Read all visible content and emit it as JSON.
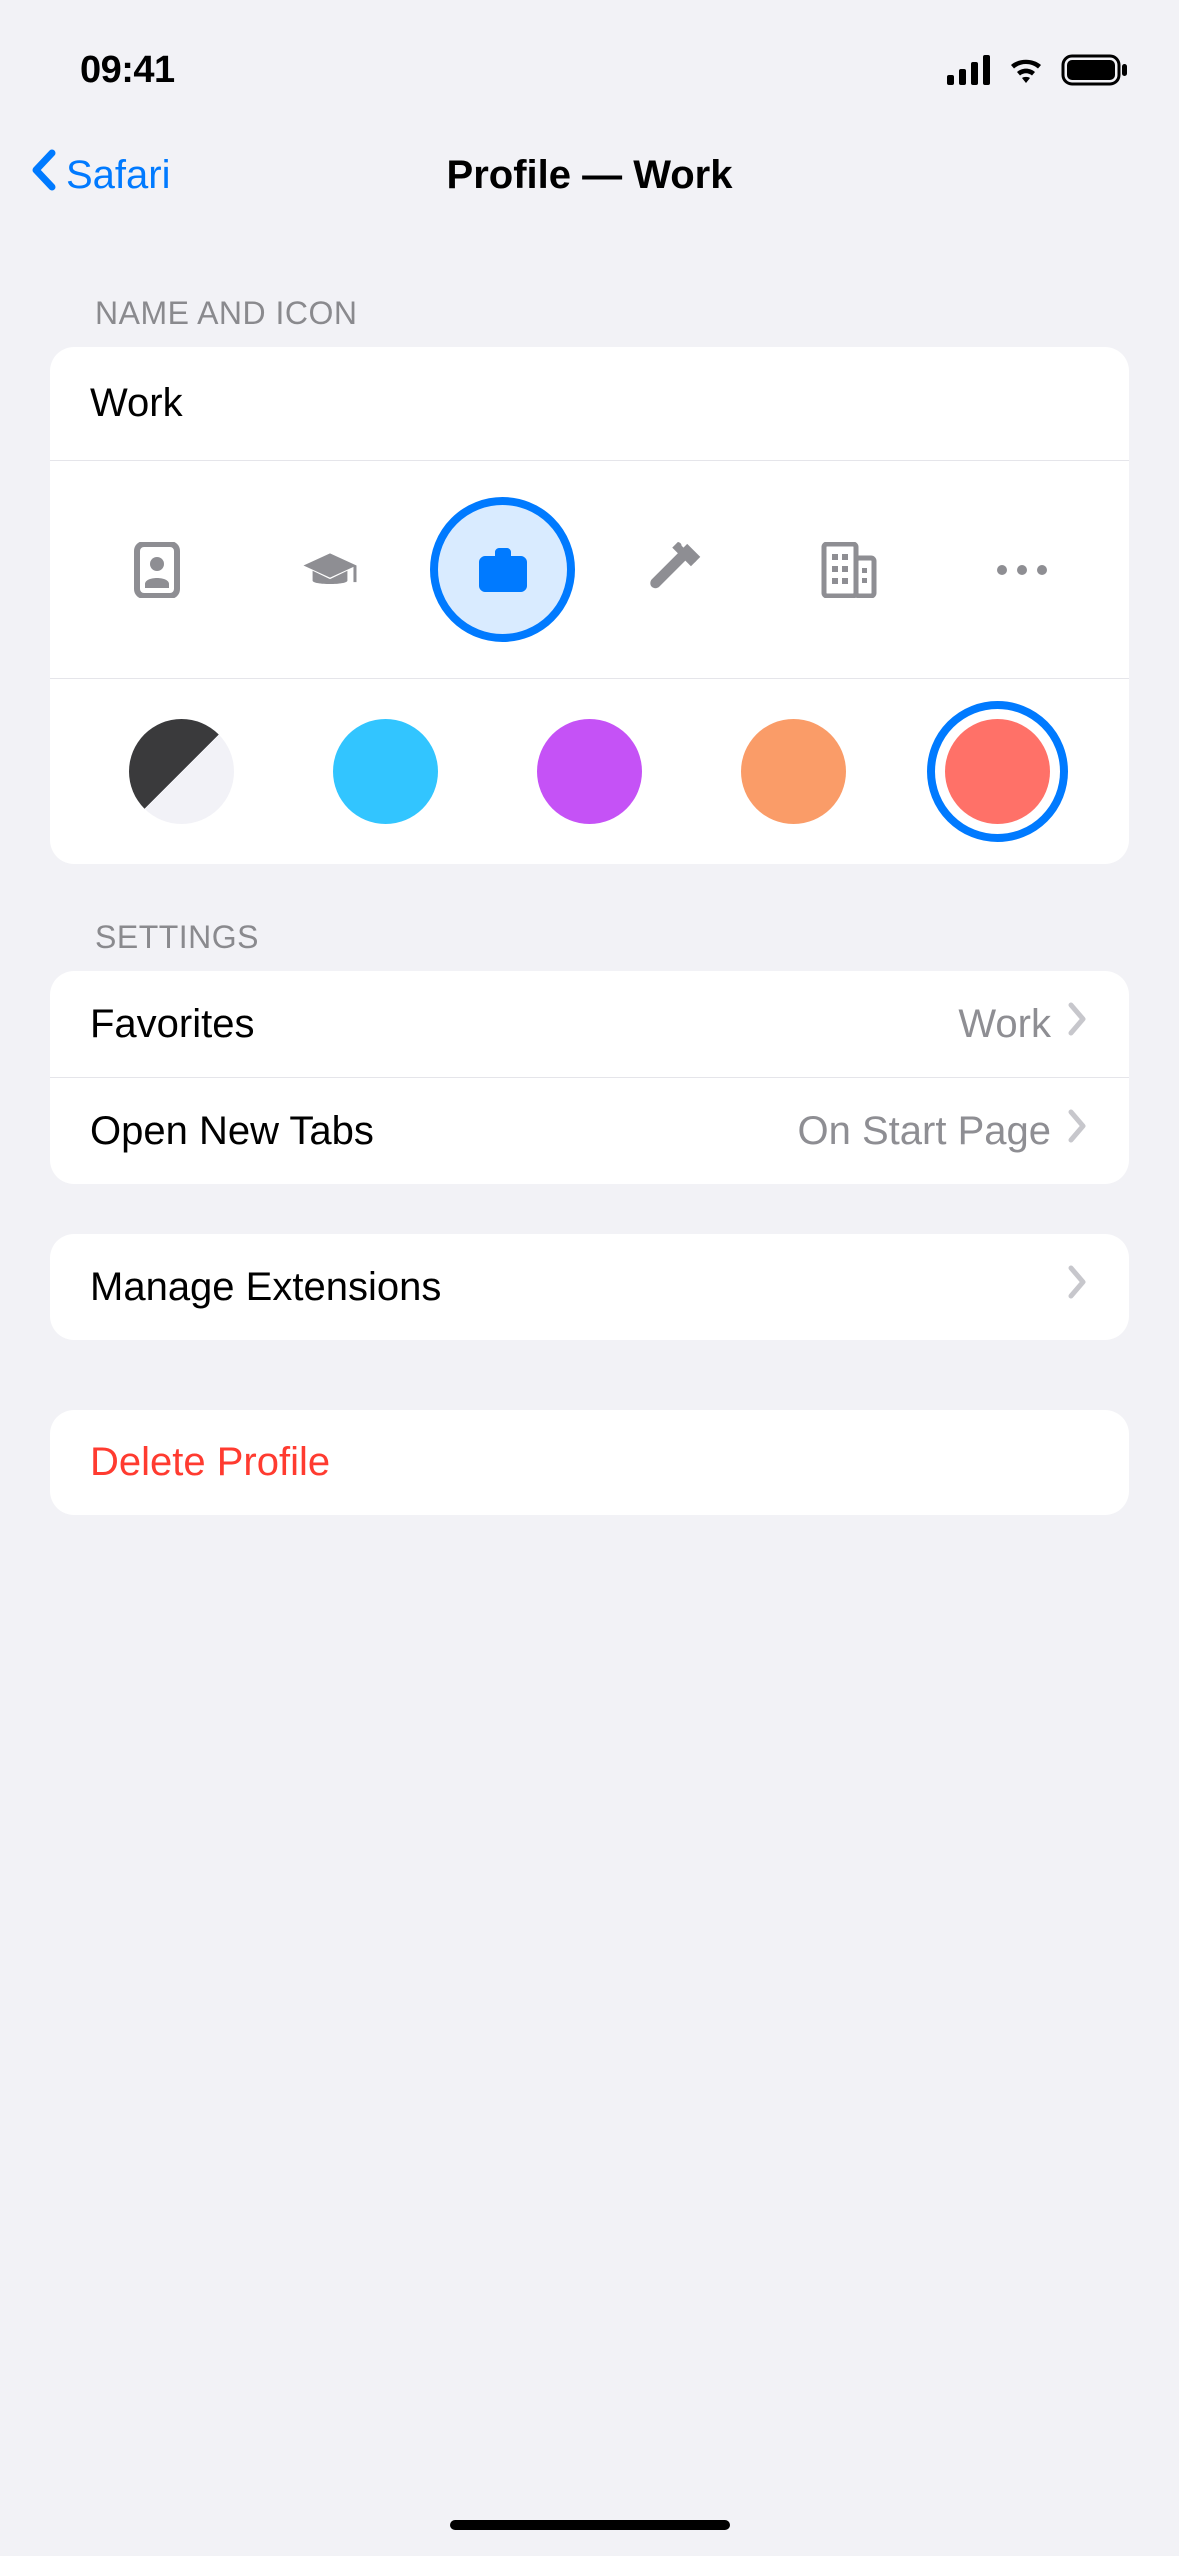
{
  "status": {
    "time": "09:41"
  },
  "nav": {
    "back_label": "Safari",
    "title": "Profile — Work"
  },
  "sections": {
    "name_icon_header": "NAME AND ICON",
    "settings_header": "SETTINGS"
  },
  "profile": {
    "name": "Work",
    "icons": [
      {
        "id": "person-badge",
        "selected": false
      },
      {
        "id": "graduation-cap",
        "selected": false
      },
      {
        "id": "briefcase",
        "selected": true
      },
      {
        "id": "hammer",
        "selected": false
      },
      {
        "id": "building",
        "selected": false
      },
      {
        "id": "more",
        "selected": false
      }
    ],
    "colors": [
      {
        "id": "black-white",
        "hex": "bw",
        "selected": false
      },
      {
        "id": "sky-blue",
        "hex": "#32c5ff",
        "selected": false
      },
      {
        "id": "purple",
        "hex": "#c552f6",
        "selected": false
      },
      {
        "id": "orange",
        "hex": "#fa9c68",
        "selected": false
      },
      {
        "id": "coral",
        "hex": "#ff7168",
        "selected": true
      }
    ]
  },
  "settings": {
    "favorites": {
      "label": "Favorites",
      "value": "Work"
    },
    "open_new_tabs": {
      "label": "Open New Tabs",
      "value": "On Start Page"
    },
    "manage_extensions": {
      "label": "Manage Extensions"
    },
    "delete_profile": {
      "label": "Delete Profile"
    }
  }
}
